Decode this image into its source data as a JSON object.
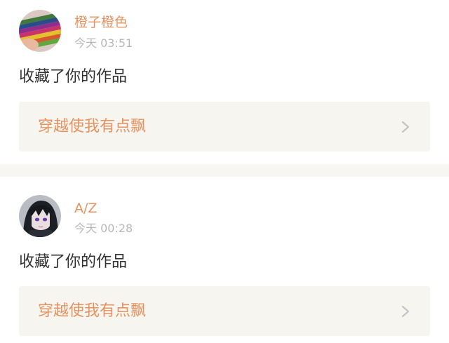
{
  "notifications": [
    {
      "username": "橙子橙色",
      "time": "今天 03:51",
      "action": "收藏了你的作品",
      "work_title": "穿越使我有点飘",
      "avatar_icon": "colored-pencils-avatar"
    },
    {
      "username": "A/Z",
      "time": "今天 00:28",
      "action": "收藏了你的作品",
      "work_title": "穿越使我有点飘",
      "avatar_icon": "anime-character-avatar"
    }
  ],
  "colors": {
    "accent": "#e59361",
    "muted": "#b8b8b8",
    "text": "#333333",
    "link_bg": "#f6f5f0",
    "separator": "#f7f6f3"
  }
}
